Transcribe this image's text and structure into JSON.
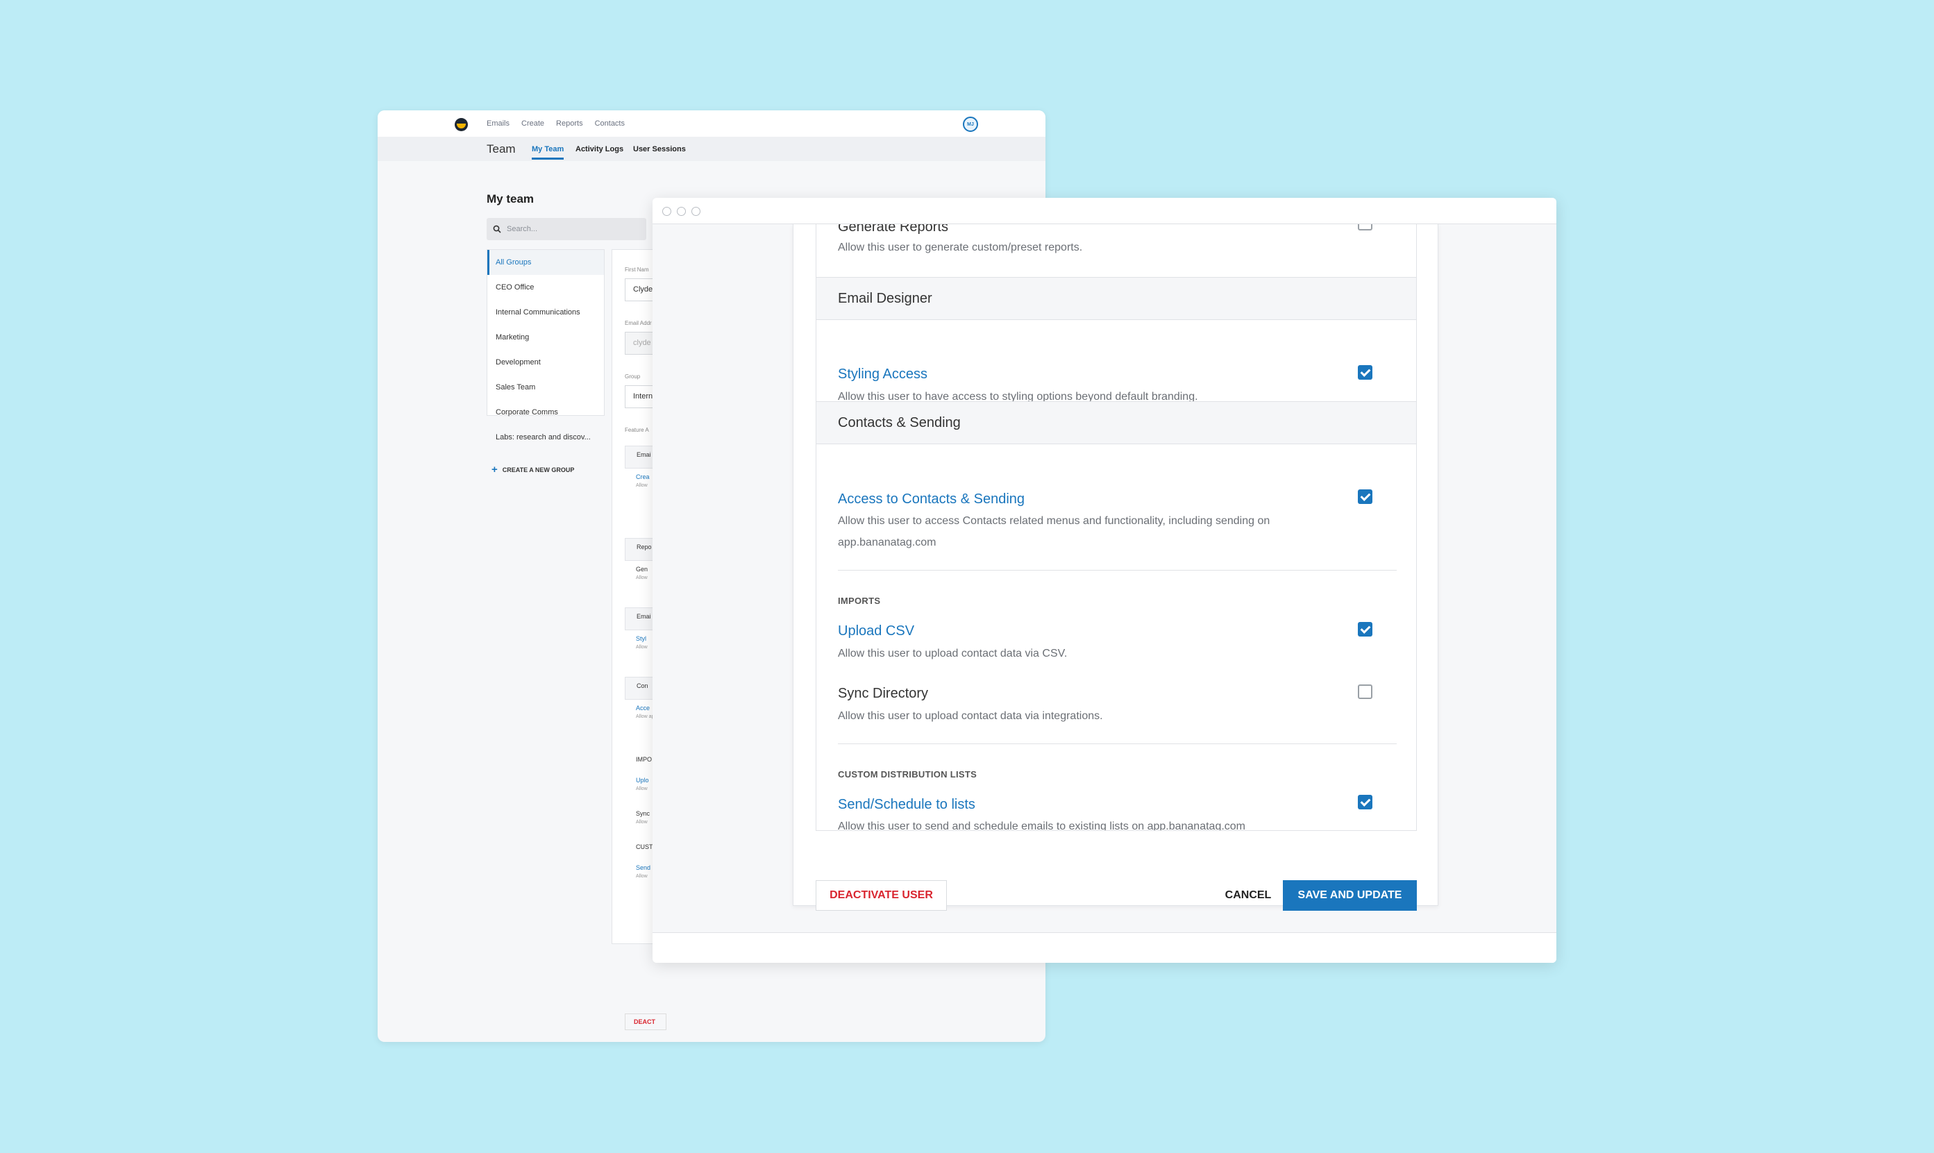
{
  "back_window": {
    "top_nav": [
      "Emails",
      "Create",
      "Reports",
      "Contacts"
    ],
    "avatar_initials": "MJ",
    "sub_title": "Team",
    "tabs": [
      {
        "label": "My Team",
        "active": true
      },
      {
        "label": "Activity Logs",
        "active": false
      },
      {
        "label": "User Sessions",
        "active": false
      }
    ],
    "section_title": "My team",
    "search_placeholder": "Search...",
    "groups": [
      "All Groups",
      "CEO Office",
      "Internal Communications",
      "Marketing",
      "Development",
      "Sales Team",
      "Corporate Comms",
      "Labs: research and discov..."
    ],
    "create_group_label": "CREATE A NEW GROUP",
    "form": {
      "first_name_label": "First Nam",
      "first_name_value": "Clyde",
      "email_label": "Email Addr",
      "email_value": "clyde",
      "group_label": "Group",
      "group_value": "Interna",
      "feature_label": "Feature A",
      "rows": [
        {
          "type": "head",
          "title": "Emai"
        },
        {
          "type": "body",
          "title": "Crea",
          "desc": "Allow",
          "blue": true
        },
        {
          "type": "head",
          "title": "Repo"
        },
        {
          "type": "body",
          "title": "Gen",
          "desc": "Allow",
          "blue": false
        },
        {
          "type": "head",
          "title": "Emai"
        },
        {
          "type": "body",
          "title": "Styl",
          "desc": "Allow",
          "blue": true
        },
        {
          "type": "head",
          "title": "Con"
        },
        {
          "type": "body",
          "title": "Acce",
          "desc": "Allow app.b",
          "blue": true
        },
        {
          "type": "body",
          "title": "IMPO",
          "desc": "",
          "blue": false
        },
        {
          "type": "body",
          "title": "Uplo",
          "desc": "Allow",
          "blue": true
        },
        {
          "type": "body",
          "title": "Sync",
          "desc": "Allow",
          "blue": false
        },
        {
          "type": "body",
          "title": "CUST",
          "desc": "",
          "blue": false
        },
        {
          "type": "body",
          "title": "Send",
          "desc": "Allow",
          "blue": true
        }
      ],
      "deactivate_short": "DEACT"
    }
  },
  "modal": {
    "generate_reports": {
      "title": "Generate Reports",
      "desc": "Allow this user to generate custom/preset reports.",
      "checked": false
    },
    "sections": {
      "email_designer": "Email Designer",
      "contacts_sending": "Contacts & Sending"
    },
    "styling_access": {
      "title": "Styling Access",
      "desc": "Allow this user to have access to styling options beyond default branding.",
      "checked": true
    },
    "access_contacts": {
      "title": "Access to Contacts & Sending",
      "desc": "Allow this user to access Contacts related menus and functionality, including sending on app.bananatag.com",
      "checked": true
    },
    "imports_label": "IMPORTS",
    "upload_csv": {
      "title": "Upload CSV",
      "desc": "Allow this user to upload contact data via CSV.",
      "checked": true
    },
    "sync_directory": {
      "title": "Sync Directory",
      "desc": "Allow this user to upload contact data via integrations.",
      "checked": false
    },
    "custom_lists_label": "CUSTOM DISTRIBUTION LISTS",
    "send_schedule": {
      "title": "Send/Schedule to lists",
      "desc": "Allow this user to send and schedule emails to existing lists on app.bananatag.com",
      "checked": true
    },
    "buttons": {
      "deactivate": "DEACTIVATE USER",
      "cancel": "CANCEL",
      "save": "SAVE AND UPDATE"
    }
  },
  "colors": {
    "background": "#bdecf6",
    "accent": "#1a76bd",
    "danger": "#d9252f"
  }
}
